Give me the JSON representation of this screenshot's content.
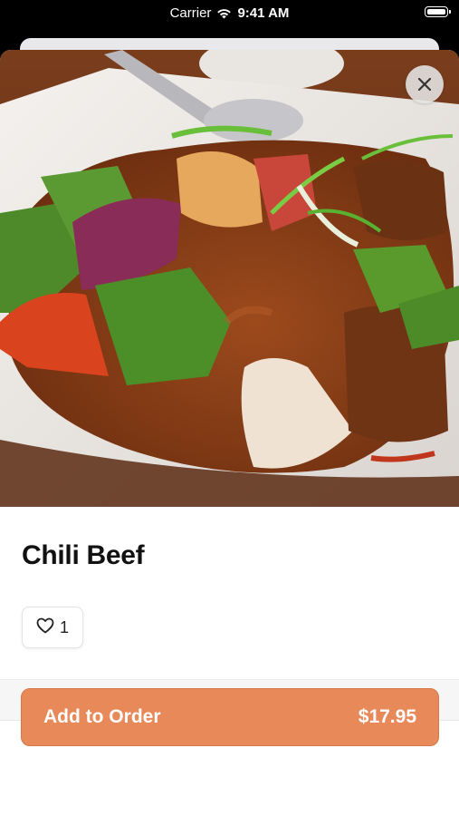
{
  "status_bar": {
    "carrier": "Carrier",
    "time": "9:41 AM"
  },
  "item": {
    "title": "Chili Beef",
    "like_count": "1",
    "image_alt": "plate of chili beef with peppers and onions"
  },
  "order_button": {
    "label": "Add to Order",
    "price": "$17.95",
    "color": "#e8895a"
  },
  "icons": {
    "close": "close-icon",
    "like": "heart-icon",
    "wifi": "wifi-icon",
    "battery": "battery-icon"
  }
}
